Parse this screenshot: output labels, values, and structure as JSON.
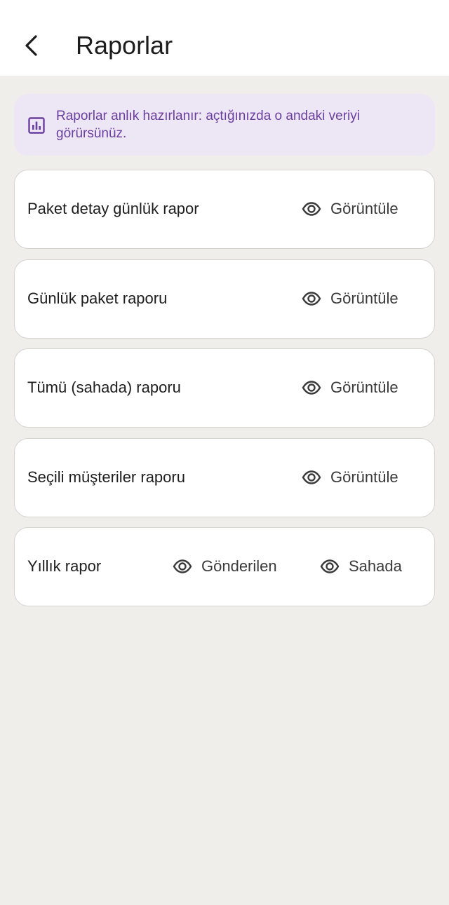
{
  "header": {
    "title": "Raporlar",
    "back_icon": "chevron-left-icon"
  },
  "info_banner": {
    "icon": "bar-chart-icon",
    "text": "Raporlar anlık hazırlanır: açtığınızda o andaki veriyi görürsünüz."
  },
  "reports": [
    {
      "title": "Paket detay günlük rapor",
      "actions": [
        {
          "label": "Görüntüle",
          "icon": "eye-icon"
        }
      ]
    },
    {
      "title": "Günlük paket raporu",
      "actions": [
        {
          "label": "Görüntüle",
          "icon": "eye-icon"
        }
      ]
    },
    {
      "title": "Tümü (sahada) raporu",
      "actions": [
        {
          "label": "Görüntüle",
          "icon": "eye-icon"
        }
      ]
    },
    {
      "title": "Seçili müşteriler raporu",
      "actions": [
        {
          "label": "Görüntüle",
          "icon": "eye-icon"
        }
      ]
    },
    {
      "title": "Yıllık rapor",
      "actions": [
        {
          "label": "Gönderilen",
          "icon": "eye-icon"
        },
        {
          "label": "Sahada",
          "icon": "eye-icon"
        }
      ]
    }
  ],
  "colors": {
    "background": "#efeeea",
    "banner_bg": "#ece6f5",
    "banner_text": "#6b3f9e",
    "card_border": "#d6d4cf"
  }
}
